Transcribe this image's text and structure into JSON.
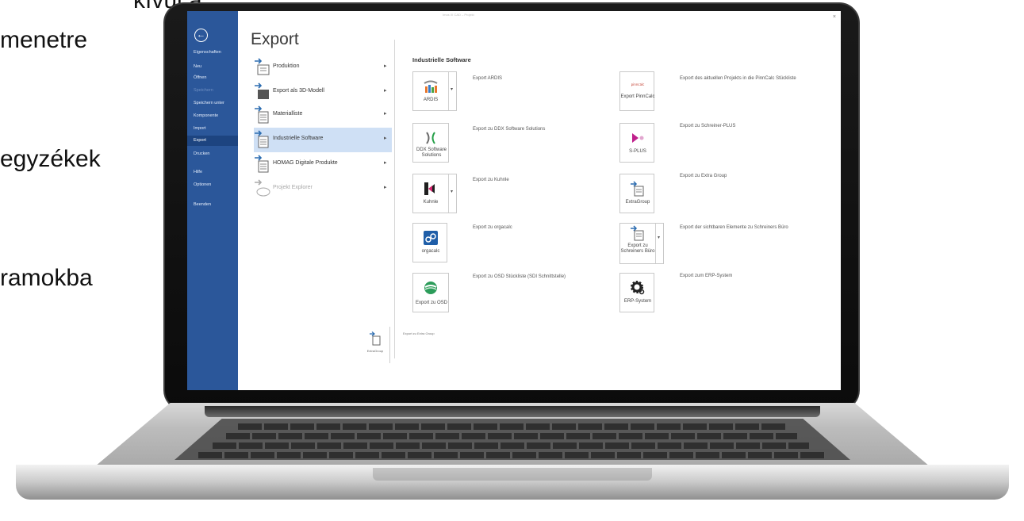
{
  "slide": {
    "lines": [
      "kívül a",
      "menetre",
      "egyzékek",
      "ramokba"
    ]
  },
  "window": {
    "close_label": "×",
    "top_caption": "Imos iX CAD – Projekt"
  },
  "sidebar": {
    "back_icon": "back-arrow-icon",
    "items": [
      {
        "label": "Eigenschaften"
      },
      {
        "label": "Neu"
      },
      {
        "label": "Öffnen"
      },
      {
        "label": "Speichern"
      },
      {
        "label": "Speichern unter"
      },
      {
        "label": "Komponente"
      },
      {
        "label": "Import"
      },
      {
        "label": "Export"
      },
      {
        "label": "Drucken"
      },
      {
        "label": "Hilfe"
      },
      {
        "label": "Optionen"
      },
      {
        "label": "Beenden"
      }
    ],
    "accent_color": "#2b579a"
  },
  "main": {
    "title": "Export",
    "menu": [
      {
        "label": "Produktion",
        "icon": "production-export-icon"
      },
      {
        "label": "Export als 3D-Modell",
        "icon": "3d-model-export-icon"
      },
      {
        "label": "Materialliste",
        "icon": "material-list-icon"
      },
      {
        "label": "Industrielle Software",
        "icon": "industrial-software-icon"
      },
      {
        "label": "HOMAG Digitale Produkte",
        "icon": "homag-digital-icon"
      },
      {
        "label": "Projekt Explorer",
        "icon": "project-explorer-icon"
      }
    ],
    "section_title": "Industrielle Software",
    "tiles_left": [
      {
        "label": "ARDIS",
        "desc": "Export ARDIS",
        "icon": "ardis-icon"
      },
      {
        "label": "DDX Software Solutions",
        "desc": "Export zu DDX Software Solutions",
        "icon": "ddx-icon"
      },
      {
        "label": "Kuhnle",
        "desc": "Export zu Kuhnle",
        "icon": "kuhnle-icon"
      },
      {
        "label": "orgacalc",
        "desc": "Export zu orgacalc",
        "icon": "orgacalc-icon"
      },
      {
        "label": "Export zu OSD",
        "desc": "Export zu OSD Stückliste (SDI Schnittstelle)",
        "icon": "osd-icon"
      }
    ],
    "tiles_right": [
      {
        "label": "Export PinnCalc",
        "desc": "Export des aktuellen Projekts in die PinnCalc Stückliste",
        "icon": "pinncalc-icon"
      },
      {
        "label": "S-PLUS",
        "desc": "Export zu Schreiner-PLUS",
        "icon": "splus-icon"
      },
      {
        "label": "ExtraGroup",
        "desc": "Export zu Extra Group",
        "icon": "extragroup-icon"
      },
      {
        "label": "Export zu Schreiners Büro",
        "desc": "Export der sichtbaren Elemente zu Schreiners Büro",
        "icon": "schreiners-buero-icon"
      },
      {
        "label": "ERP-System",
        "desc": "Export zum ERP-System",
        "icon": "erp-gear-icon"
      }
    ],
    "floating_tile": {
      "label": "ExtraGroup",
      "caption": "Export zu Extra Group"
    },
    "active_color": "#cfe0f5"
  }
}
